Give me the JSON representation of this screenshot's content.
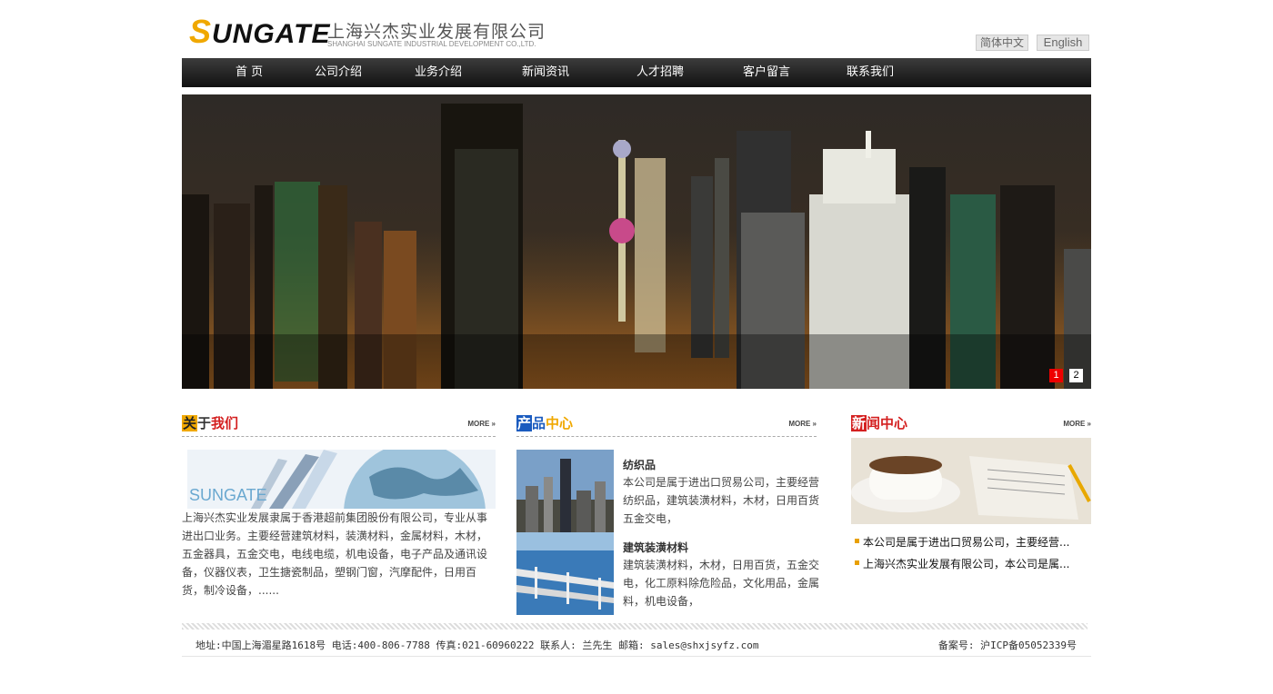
{
  "header": {
    "logo_text": "SUNGATE",
    "company_cn": "上海兴杰实业发展有限公司",
    "company_en": "SHANGHAI SUNGATE INDUSTRIAL DEVELOPMENT CO.,LTD.",
    "lang_cn": "简体中文",
    "lang_en": "English"
  },
  "nav": [
    "首 页",
    "公司介绍",
    "业务介绍",
    "新闻资讯",
    "人才招聘",
    "客户留言",
    "联系我们"
  ],
  "banner": {
    "slides": [
      "1",
      "2"
    ],
    "active": 0
  },
  "about": {
    "title_a": "关",
    "title_b": "于",
    "title_c": "我们",
    "more": "MORE »",
    "img_text": "SUNGATE",
    "text": "上海兴杰实业发展隶属于香港超前集团股份有限公司，专业从事进出口业务。主要经营建筑材料，装潢材料，金属材料，木材，五金器具，五金交电，电线电缆，机电设备，电子产品及通讯设备，仪器仪表，卫生搪瓷制品，塑钢门窗，汽摩配件，日用百货，制冷设备，......"
  },
  "products": {
    "title_a": "产",
    "title_b": "品",
    "title_c": "中心",
    "more": "MORE »",
    "items": [
      {
        "name": "纺织品",
        "desc": "本公司是属于进出口贸易公司，主要经营纺织品，建筑装潢材料，木材，日用百货五金交电，"
      },
      {
        "name": "建筑装潢材料",
        "desc": "建筑装潢材料，木材，日用百货，五金交电，化工原料除危险品，文化用品，金属料，机电设备，"
      }
    ]
  },
  "news": {
    "title_a": "新",
    "title_b": "闻",
    "title_c": "中心",
    "more": "MORE »",
    "items": [
      "本公司是属于进出口贸易公司，主要经营...",
      "上海兴杰实业发展有限公司，本公司是属..."
    ]
  },
  "footer": {
    "contact": "地址:中国上海湄星路1618号 电话:400-806-7788   传真:021-60960222 联系人: 兰先生 邮箱: sales@shxjsyfz.com",
    "icp": "备案号: 沪ICP备05052339号"
  },
  "colors": {
    "nav_bg": "#1e1e1e",
    "accent_red": "#d42020",
    "accent_orange": "#f0a800",
    "accent_blue": "#1a5bbf"
  }
}
